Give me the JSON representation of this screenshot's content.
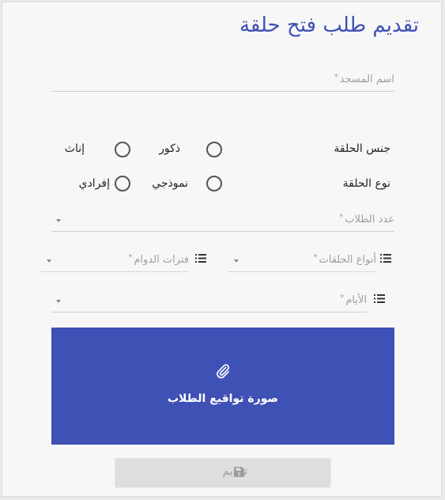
{
  "form": {
    "title": "تقديم طلب فتح حلقة",
    "mosque_name": {
      "label": "اسم المسجد",
      "required_mark": "*",
      "value": ""
    },
    "circle_gender": {
      "label": "جنس الحلقة",
      "options": [
        "ذكور",
        "إناث"
      ],
      "selected": null
    },
    "circle_type": {
      "label": "نوع الحلقة",
      "options": [
        "نموذجي",
        "إفرادي"
      ],
      "selected": null
    },
    "students_count": {
      "label": "عدد الطلاب",
      "required_mark": "*",
      "value": ""
    },
    "circle_kinds": {
      "label": "أنواع الحلقات",
      "required_mark": "*",
      "icon": "list-icon"
    },
    "work_periods": {
      "label": "فترات الدوام",
      "required_mark": "*",
      "icon": "list-icon"
    },
    "days": {
      "label": "الأيام",
      "required_mark": "*",
      "icon": "list-icon"
    },
    "upload": {
      "label": "صورة تواقيع الطلاب",
      "icon": "paperclip-icon",
      "background": "#3f51b5"
    },
    "submit": {
      "label": "تقديم",
      "icon": "save-icon",
      "disabled": true
    }
  },
  "colors": {
    "accent": "#3f51b5",
    "card": "#f7f7f7",
    "disabled": "#dedede"
  }
}
